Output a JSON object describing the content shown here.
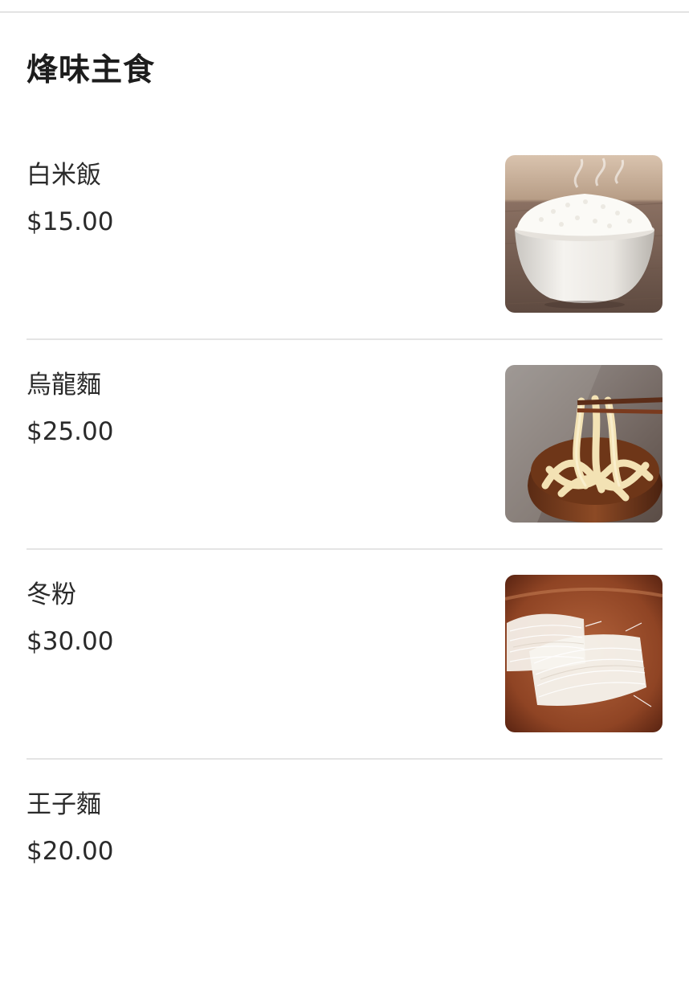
{
  "section": {
    "title": "烽味主食"
  },
  "items": [
    {
      "name": "白米飯",
      "price": "$15.00",
      "photo": "steamed-rice-bowl-photo"
    },
    {
      "name": "烏龍麵",
      "price": "$25.00",
      "photo": "udon-noodles-bowl-photo"
    },
    {
      "name": "冬粉",
      "price": "$30.00",
      "photo": "glass-noodles-plate-photo"
    },
    {
      "name": "王子麵",
      "price": "$20.00",
      "photo": null
    }
  ]
}
